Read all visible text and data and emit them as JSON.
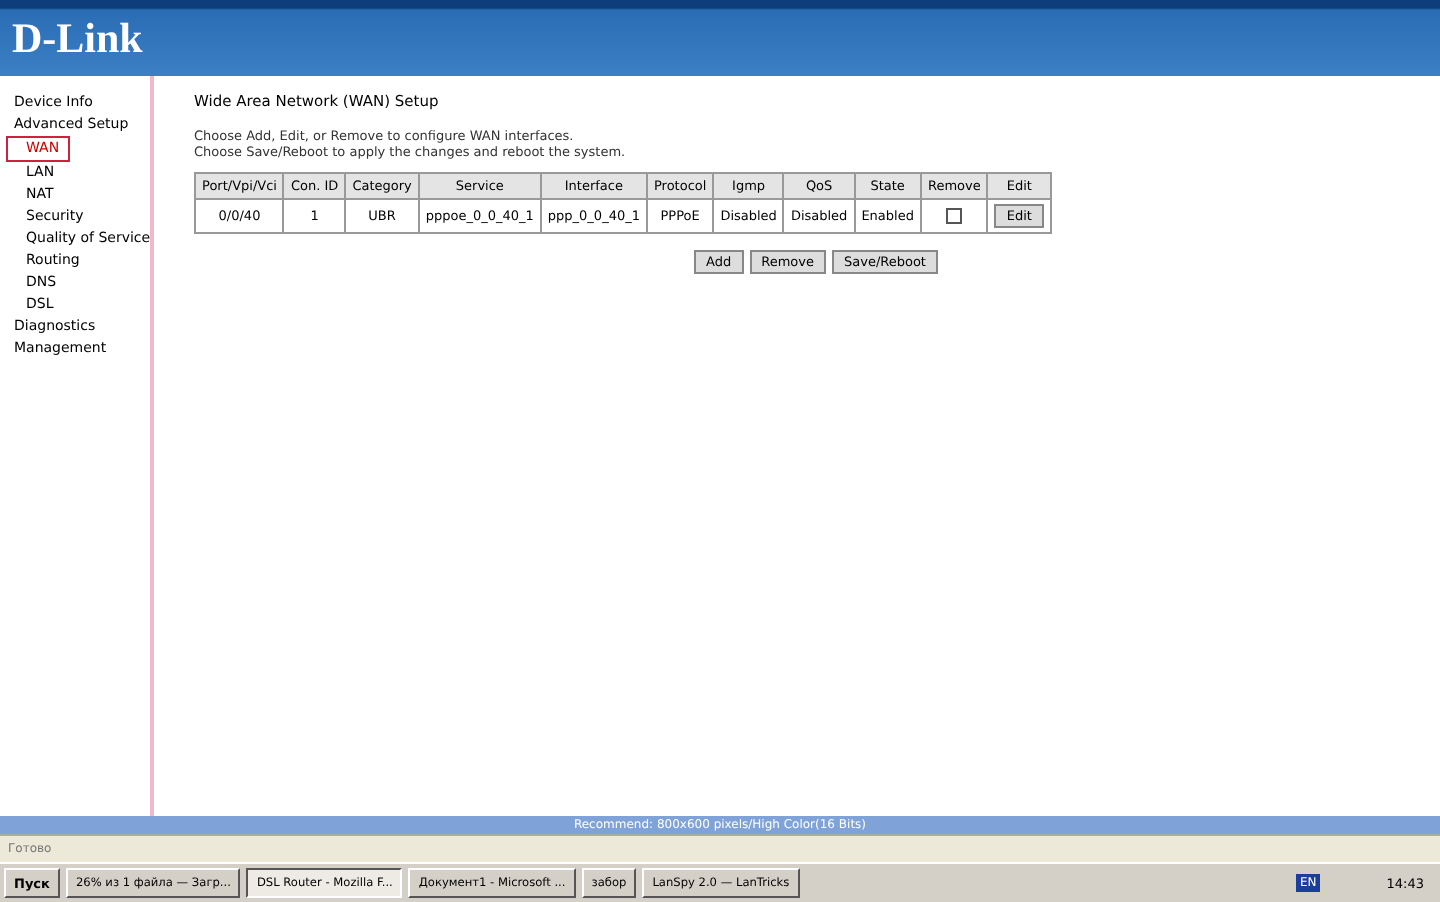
{
  "header": {
    "logo": "D-Link"
  },
  "sidebar": {
    "items": [
      {
        "label": "Device Info",
        "selected": false
      },
      {
        "label": "Advanced Setup",
        "selected": false,
        "children": [
          {
            "label": "WAN",
            "selected": true
          },
          {
            "label": "LAN",
            "selected": false
          },
          {
            "label": "NAT",
            "selected": false
          },
          {
            "label": "Security",
            "selected": false
          },
          {
            "label": "Quality of Service",
            "selected": false
          },
          {
            "label": "Routing",
            "selected": false
          },
          {
            "label": "DNS",
            "selected": false
          },
          {
            "label": "DSL",
            "selected": false
          }
        ]
      },
      {
        "label": "Diagnostics",
        "selected": false
      },
      {
        "label": "Management",
        "selected": false
      }
    ]
  },
  "content": {
    "title": "Wide Area Network (WAN) Setup",
    "instructions": [
      "Choose Add, Edit, or Remove to configure WAN interfaces.",
      "Choose Save/Reboot to apply the changes and reboot the system."
    ],
    "table": {
      "columns": [
        "Port/Vpi/Vci",
        "Con. ID",
        "Category",
        "Service",
        "Interface",
        "Protocol",
        "Igmp",
        "QoS",
        "State",
        "Remove",
        "Edit"
      ],
      "rows": [
        {
          "cells": [
            "0/0/40",
            "1",
            "UBR",
            "pppoe_0_0_40_1",
            "ppp_0_0_40_1",
            "PPPoE",
            "Disabled",
            "Disabled",
            "Enabled"
          ],
          "remove_checked": false,
          "edit_button": "Edit"
        }
      ]
    },
    "buttons": [
      "Add",
      "Remove",
      "Save/Reboot"
    ]
  },
  "footer_note": "Recommend: 800x600 pixels/High Color(16 Bits)",
  "status_bar": {
    "text": "Готово"
  },
  "taskbar": {
    "start": "Пуск",
    "tasks": [
      {
        "label": "26% из 1 файла — Загр...",
        "selected": false
      },
      {
        "label": "DSL Router - Mozilla F...",
        "selected": true
      },
      {
        "label": "Документ1 - Microsoft ...",
        "selected": false
      },
      {
        "label": "забор",
        "selected": false
      },
      {
        "label": "LanSpy 2.0 — LanTricks",
        "selected": false
      }
    ],
    "language": "EN",
    "clock": "14:43"
  }
}
